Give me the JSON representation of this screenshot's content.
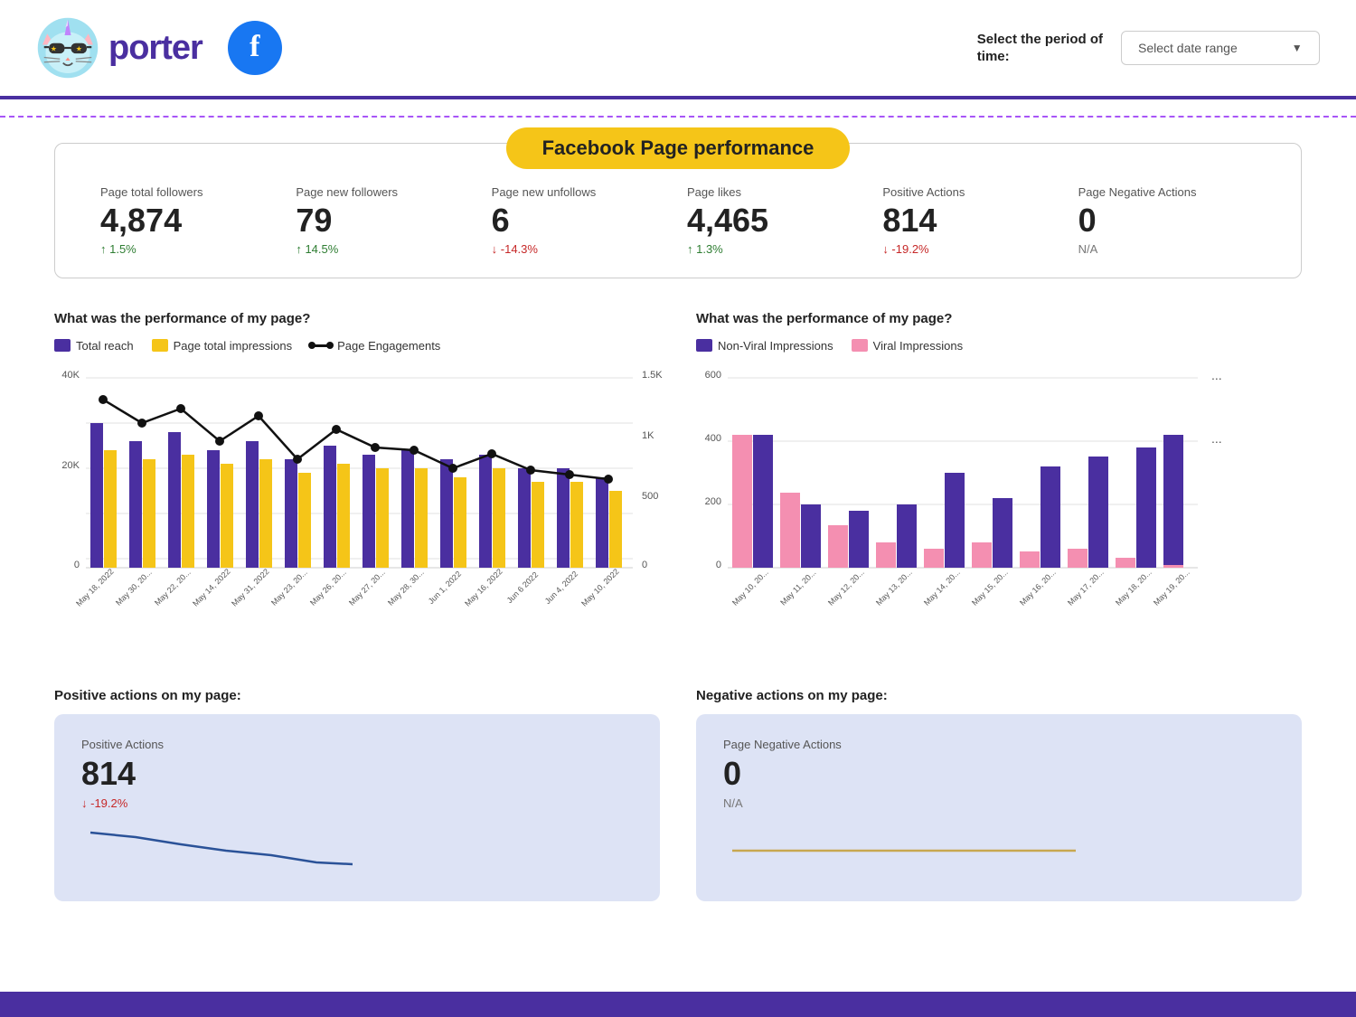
{
  "header": {
    "logo_text": "porter",
    "period_label": "Select the period of\ntime:",
    "date_range_placeholder": "Select date range"
  },
  "performance_card": {
    "title": "Facebook Page performance",
    "metrics": [
      {
        "label": "Page total followers",
        "value": "4,874",
        "change": "↑ 1.5%",
        "change_type": "up"
      },
      {
        "label": "Page new followers",
        "value": "79",
        "change": "↑ 14.5%",
        "change_type": "up"
      },
      {
        "label": "Page new unfollows",
        "value": "6",
        "change": "↓ -14.3%",
        "change_type": "down"
      },
      {
        "label": "Page likes",
        "value": "4,465",
        "change": "↑ 1.3%",
        "change_type": "up"
      },
      {
        "label": "Positive Actions",
        "value": "814",
        "change": "↓ -19.2%",
        "change_type": "down"
      },
      {
        "label": "Page Negative Actions",
        "value": "0",
        "change": "N/A",
        "change_type": "na"
      }
    ]
  },
  "chart1": {
    "title": "What was the performance of my page?",
    "legend": [
      {
        "type": "box",
        "color": "#4a2fa0",
        "label": "Total reach"
      },
      {
        "type": "box",
        "color": "#f5c518",
        "label": "Page total impressions"
      },
      {
        "type": "line",
        "color": "#111",
        "label": "Page Engagements"
      }
    ],
    "x_labels": [
      "May 18, 2022",
      "May 30, 20...",
      "May 22, 20...",
      "May 14, 2022",
      "May 31, 2022",
      "May 23, 20...",
      "May 26, 20...",
      "May 27, 20...",
      "May 28, 30...",
      "Jun 1, 2022",
      "May 16, 2022",
      "Jun 6 2022",
      "Jun 4, 2022",
      "May 10, 2022"
    ],
    "y_left_labels": [
      "40K",
      "20K",
      "0"
    ],
    "y_right_labels": [
      "1.5K",
      "1K",
      "500",
      "0"
    ]
  },
  "chart2": {
    "title": "What was the performance of my page?",
    "legend": [
      {
        "type": "box",
        "color": "#4a2fa0",
        "label": "Non-Viral Impressions"
      },
      {
        "type": "box",
        "color": "#f48fb1",
        "label": "Viral Impressions"
      }
    ],
    "x_labels": [
      "May 10, 20...",
      "May 11, 20...",
      "May 12, 20...",
      "May 13, 20...",
      "May 14, 20...",
      "May 15, 20...",
      "May 16, 20...",
      "May 17, 20...",
      "May 18, 20...",
      "May 19, 20..."
    ],
    "y_labels": [
      "600",
      "400",
      "200",
      "0"
    ]
  },
  "positive_actions_card": {
    "section_title": "Positive actions on my page:",
    "label": "Positive Actions",
    "value": "814",
    "change": "↓ -19.2%",
    "change_type": "down"
  },
  "negative_actions_card": {
    "section_title": "Negative actions on my page:",
    "label": "Page Negative Actions",
    "value": "0",
    "change": "N/A",
    "change_type": "na"
  }
}
